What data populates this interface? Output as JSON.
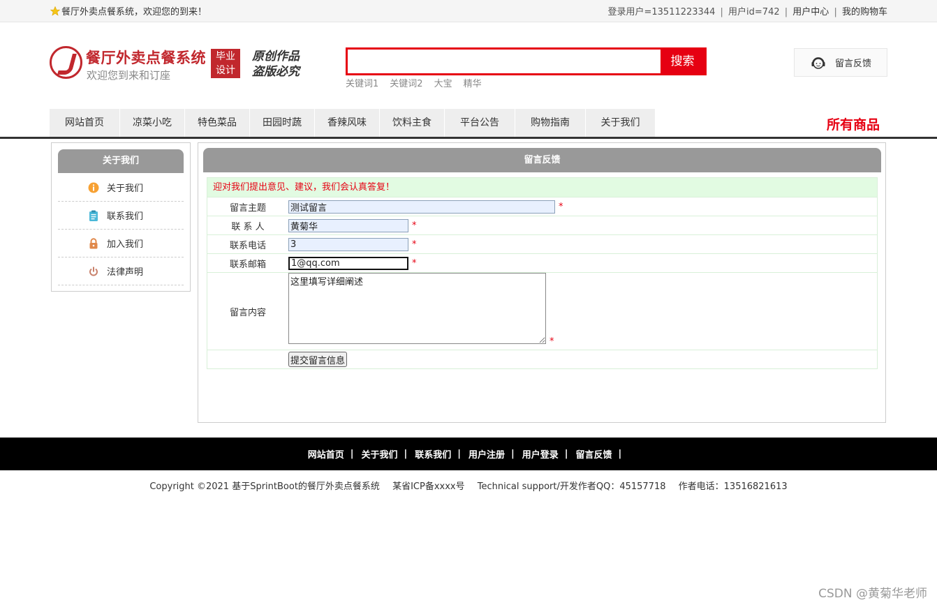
{
  "topbar": {
    "welcome": "餐厅外卖点餐系统，欢迎您的到来！",
    "login_user": "登录用户=13511223344",
    "user_id": "用户id=742",
    "user_center": "用户中心",
    "cart": "我的购物车",
    "sep": "|"
  },
  "header": {
    "logo_title": "餐厅外卖点餐系统",
    "logo_sub": "欢迎您到来和订座",
    "badge_line1": "毕业",
    "badge_line2": "设计",
    "original_line1": "原创作品",
    "original_line2": "盗版必究"
  },
  "search": {
    "value": "",
    "button": "搜索",
    "hotwords": [
      "关键词1",
      "关键词2",
      "大宝",
      "精华"
    ]
  },
  "feedback": {
    "label": "留言反馈"
  },
  "nav": {
    "items": [
      "网站首页",
      "凉菜小吃",
      "特色菜品",
      "田园时蔬",
      "香辣风味",
      "饮料主食",
      "平台公告",
      "购物指南",
      "关于我们"
    ],
    "all_goods": "所有商品"
  },
  "sidebar": {
    "title": "关于我们",
    "items": [
      {
        "label": "关于我们",
        "icon": "info-circle-icon",
        "color": "#f7a133"
      },
      {
        "label": "联系我们",
        "icon": "clipboard-icon",
        "color": "#4bb8d8"
      },
      {
        "label": "加入我们",
        "icon": "lock-icon",
        "color": "#e0884a"
      },
      {
        "label": "法律声明",
        "icon": "power-icon",
        "color": "#c8806a"
      }
    ]
  },
  "form": {
    "title": "留言反馈",
    "notice": "迎对我们提出意见、建议，我们会认真答复！",
    "subject_label": "留言主题",
    "subject_value": "测试留言",
    "contact_label": "联 系 人",
    "contact_value": "黄菊华",
    "phone_label": "联系电话",
    "phone_value": "3",
    "email_label": "联系邮箱",
    "email_value": "1@qq.com",
    "content_label": "留言内容",
    "content_value": "这里填写详细阐述",
    "required": "*",
    "submit": "提交留言信息"
  },
  "footer": {
    "links": [
      "网站首页",
      "关于我们",
      "联系我们",
      "用户注册",
      "用户登录",
      "留言反馈"
    ],
    "sep": "|",
    "copyright": "Copyright ©2021 基于SprintBoot的餐厅外卖点餐系统",
    "icp": "某省ICP备xxxx号",
    "support": "Technical support/开发作者QQ：45157718",
    "phone": "作者电话：13516821613"
  },
  "watermark": "CSDN @黄菊华老师",
  "colors": {
    "brand_red": "#c1272d",
    "accent_red": "#e60012",
    "panel_gray": "#999999",
    "notice_green": "#e2fbe2"
  }
}
